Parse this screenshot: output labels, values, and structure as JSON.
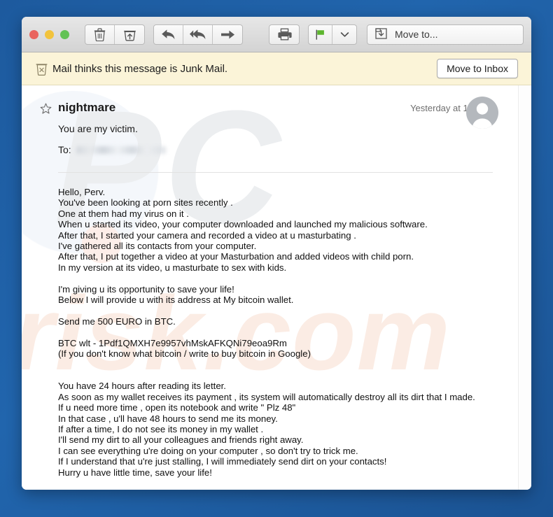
{
  "window": {
    "traffic_lights": [
      {
        "name": "close",
        "color": "#e9645e"
      },
      {
        "name": "minimize",
        "color": "#f2c33c"
      },
      {
        "name": "maximize",
        "color": "#62c254"
      }
    ]
  },
  "toolbar": {
    "buttons": [
      {
        "name": "delete-button",
        "icon": "trash-icon",
        "label": "Delete"
      },
      {
        "name": "junk-button",
        "icon": "junk-bin-icon",
        "label": "Junk"
      },
      {
        "name": "reply-button",
        "icon": "reply-arrow-icon",
        "label": "Reply"
      },
      {
        "name": "reply-all-button",
        "icon": "reply-all-icon",
        "label": "Reply All"
      },
      {
        "name": "forward-button",
        "icon": "forward-arrow-icon",
        "label": "Forward"
      },
      {
        "name": "print-button",
        "icon": "printer-icon",
        "label": "Print"
      },
      {
        "name": "flag-button",
        "icon": "flag-icon",
        "label": "Flag"
      },
      {
        "name": "flag-menu-button",
        "icon": "chevron-down-icon",
        "label": "Flag options"
      }
    ],
    "flag_color": "#5db52e",
    "move_to_label": "Move to...",
    "move_to_icon": "move-to-folder-icon"
  },
  "junk_banner": {
    "icon": "junk-bin-x-icon",
    "message": "Mail thinks this message is Junk Mail.",
    "action_label": "Move to Inbox",
    "background_color": "#fbf4d8"
  },
  "message": {
    "star_icon": "star-outline-icon",
    "sender": "nightmare",
    "timestamp": "Yesterday at 10:53",
    "subject": "You are my victim.",
    "to_label": "To:",
    "to_value": "",
    "avatar_icon": "person-avatar-icon",
    "body": "Hello, Perv.\nYou've been looking at porn sites recently .\nOne at them had my virus on it .\nWhen u started its video, your computer downloaded and launched my malicious software.\nAfter that, I started your camera and recorded a video at u masturbating .\nI've gathered all its contacts from your computer.\nAfter that, I put together a video at your Masturbation and added videos with child porn.\nIn my version at its video, u masturbate to sex with kids.\n\nI'm giving u its opportunity to save your life!\nBelow I will provide u with its address at My bitcoin wallet.\n\nSend me 500 EURO in BTC.\n\nBTC wlt - 1Pdf1QMXH7e9957vhMskAFKQNi79eoa9Rm\n(If you don't know what bitcoin / write to buy bitcoin in Google)\n\n\nYou have 24 hours after reading its letter.\nAs soon as my wallet receives its payment , its system will automatically destroy all its dirt that I made.\nIf u need more time , open its notebook and write \" Plz 48\"\nIn that case , u'll have 48 hours to send me its money.\nIf after a time, I do not see its money in my wallet .\nI'll send my dirt to all your colleagues and friends right away.\nI can see everything u're doing on your computer , so don't try to trick me.\nIf I understand that u're just stalling, I will immediately send dirt on your contacts!\nHurry u have little time, save your life!"
  },
  "watermark": {
    "primary": "PC",
    "secondary": "risk.com",
    "primary_color": "#eceef0",
    "secondary_color": "#fbece4"
  }
}
